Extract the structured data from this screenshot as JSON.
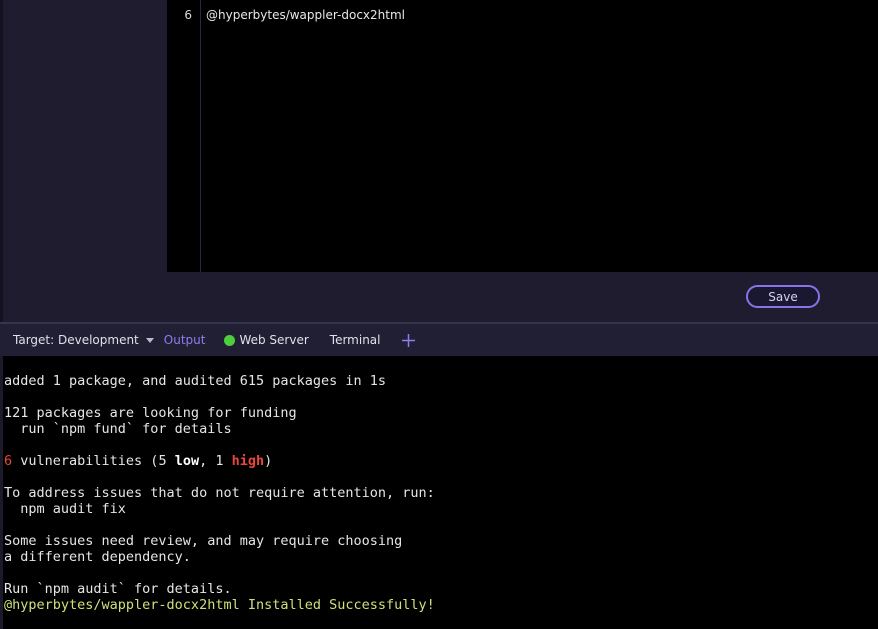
{
  "editor": {
    "line_number": "6",
    "code_text": "@hyperbytes/wappler-docx2html",
    "save_label": "Save"
  },
  "tabs": {
    "target_label": "Target: Development",
    "output_label": "Output",
    "web_server_label": "Web Server",
    "terminal_label": "Terminal",
    "add_icon": "plus-icon"
  },
  "terminal": {
    "line1": "added 1 package, and audited 615 packages in 1s",
    "line2": "121 packages are looking for funding",
    "line3": "  run `npm fund` for details",
    "vuln": {
      "count": "6",
      "mid": " vulnerabilities (5 ",
      "low": "low",
      "comma": ", 1 ",
      "high": "high",
      "close": ")"
    },
    "line5": "To address issues that do not require attention, run:",
    "line6": "  npm audit fix",
    "line7": "Some issues need review, and may require choosing",
    "line8": "a different dependency.",
    "line9": "Run `npm audit` for details.",
    "success": "@hyperbytes/wappler-docx2html Installed Successfully!"
  },
  "colors": {
    "accent": "#8f7df0",
    "status_green": "#4ccf3b",
    "error_red": "#e8473b",
    "success_text": "#cbe27a"
  }
}
